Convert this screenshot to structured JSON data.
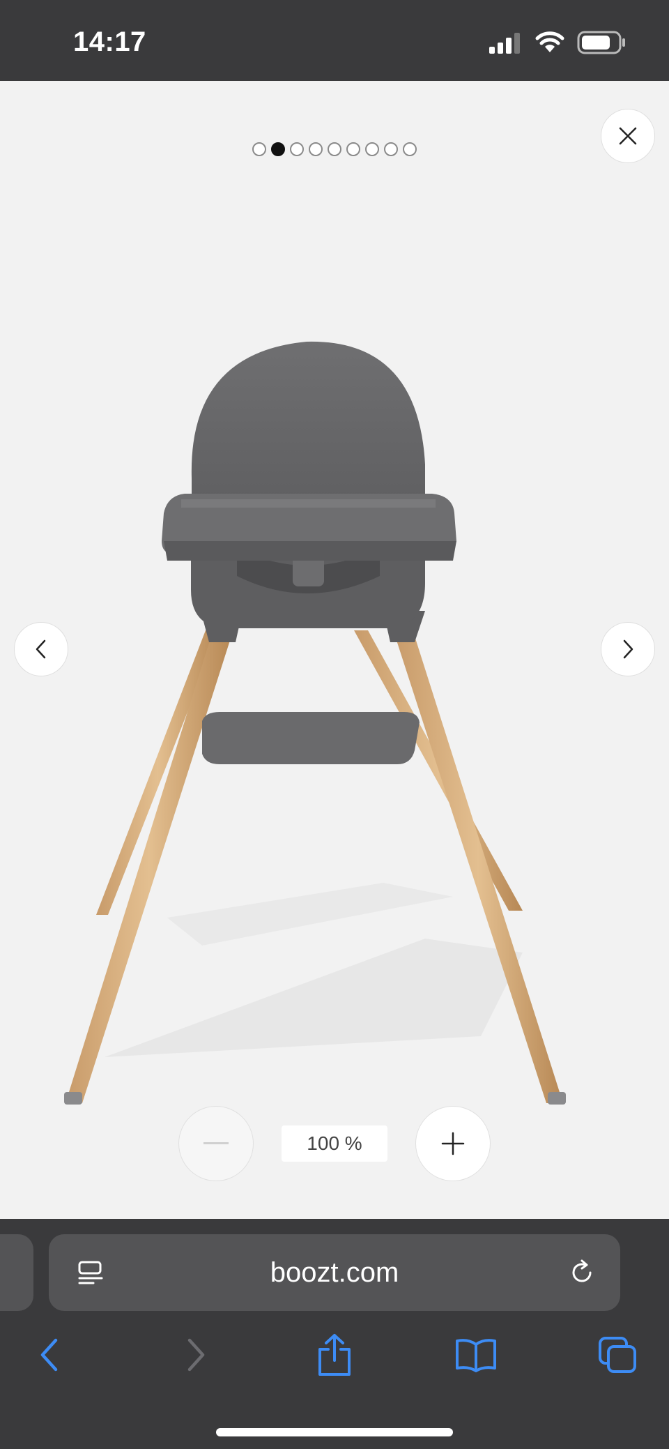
{
  "status_bar": {
    "time": "14:17",
    "icons": [
      "cellular-signal-icon",
      "wifi-icon",
      "battery-icon"
    ]
  },
  "viewer": {
    "pagination": {
      "total": 9,
      "active_index": 1
    },
    "image": {
      "subject": "Grey high chair with wooden legs"
    },
    "zoom": {
      "level": "100 %"
    },
    "icons": {
      "close": "close-icon",
      "prev": "chevron-left-icon",
      "next": "chevron-right-icon",
      "zoom_out": "minus-icon",
      "zoom_in": "plus-icon"
    }
  },
  "browser": {
    "url": "boozt.com",
    "icons": [
      "reader-mode-icon",
      "reload-icon",
      "back-icon",
      "forward-icon",
      "share-icon",
      "bookmarks-icon",
      "tabs-icon"
    ]
  },
  "colors": {
    "chrome_background": "#3a3a3c",
    "viewer_background": "#f2f2f2",
    "accent_blue": "#3d8cf5",
    "disabled_gray": "#6c6c70"
  }
}
